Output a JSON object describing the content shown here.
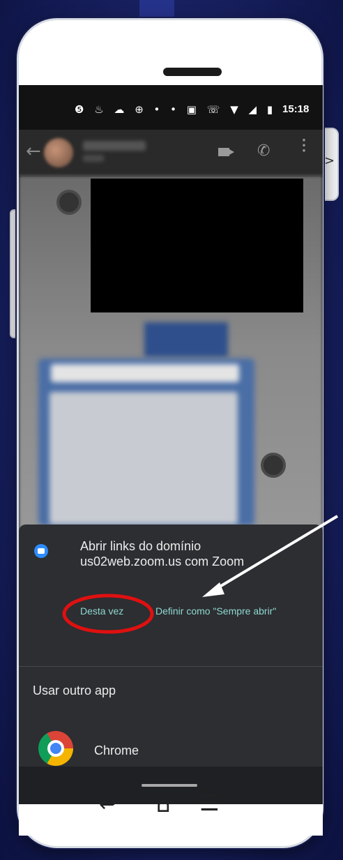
{
  "status_bar": {
    "icons": "❺ ♨ ☁ ⊕ • • ▣ ☏ ▼ ◢ ▮",
    "icon_names": [
      "facebook-icon",
      "hangouts-icon",
      "boat-icon",
      "pokeball-icon",
      "dot-icon",
      "dot-icon",
      "cast-icon",
      "volte-icon",
      "wifi-icon",
      "signal-icon",
      "battery-icon"
    ],
    "time": "15:18"
  },
  "chat_header": {
    "back_icon": "←",
    "phone_icon": "✆",
    "more_icon": "⋮"
  },
  "open_with_sheet": {
    "title": "Abrir links do domínio us02web.zoom.us com Zoom",
    "once_button": "Desta vez",
    "always_button": "Definir como \"Sempre abrir\"",
    "other_app_header": "Usar outro app",
    "apps": [
      {
        "name": "Chrome",
        "icon": "chrome-icon"
      }
    ]
  },
  "hardware_nav": {
    "back": "↩",
    "home": "⌂",
    "menu": "☰"
  },
  "side_arrow": ">",
  "colors": {
    "background": "#1b2468",
    "sheet": "#2c2e31",
    "accent_text": "#8fd8d2",
    "highlight_ring": "#e01010",
    "arrow": "#ffffff"
  }
}
